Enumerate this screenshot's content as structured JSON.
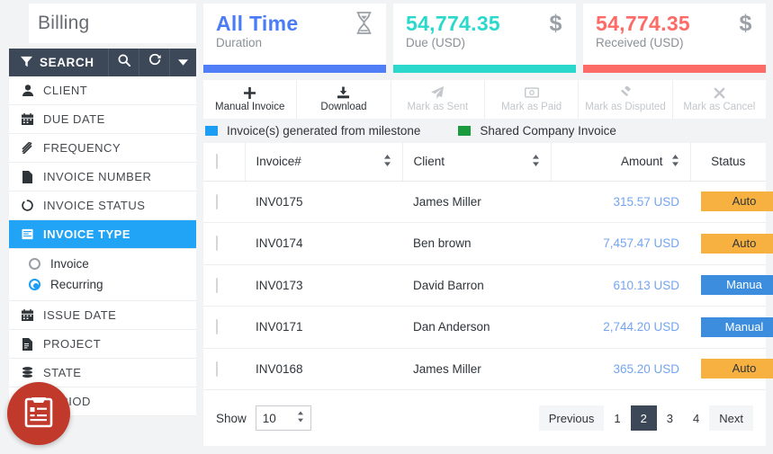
{
  "sidebar": {
    "title": "Billing",
    "search": {
      "label": "SEARCH",
      "filter_icon": "filter-icon",
      "search_icon": "search-icon",
      "refresh_icon": "refresh-icon",
      "caret_icon": "chevron-down-icon"
    },
    "items": [
      {
        "label": "CLIENT",
        "icon": "user-icon",
        "active": false
      },
      {
        "label": "DUE DATE",
        "icon": "calendar-icon",
        "active": false
      },
      {
        "label": "FREQUENCY",
        "icon": "frequency-icon",
        "active": false
      },
      {
        "label": "INVOICE NUMBER",
        "icon": "file-icon",
        "active": false
      },
      {
        "label": "INVOICE STATUS",
        "icon": "circle-notch-icon",
        "active": false
      },
      {
        "label": "INVOICE TYPE",
        "icon": "invoice-type-icon",
        "active": true
      },
      {
        "label": "ISSUE DATE",
        "icon": "calendar-icon",
        "active": false
      },
      {
        "label": "PROJECT",
        "icon": "project-file-icon",
        "active": false
      },
      {
        "label": "STATE",
        "icon": "database-icon",
        "active": false
      },
      {
        "label": "PERIOD",
        "icon": "period-icon",
        "active": false
      }
    ],
    "invoice_type_options": [
      {
        "label": "Invoice",
        "selected": false
      },
      {
        "label": "Recurring",
        "selected": true
      }
    ],
    "fab": {
      "icon": "invoice-clipboard-icon",
      "color": "#c0392b"
    }
  },
  "stats": [
    {
      "value": "All Time",
      "label": "Duration",
      "icon": "hourglass-icon",
      "value_color": "#4a7cf5",
      "bar_color": "#4f7ef7"
    },
    {
      "value": "54,774.35",
      "label": "Due (USD)",
      "icon": "dollar-icon",
      "value_color": "#2bd9cc",
      "bar_color": "#2bd9cc"
    },
    {
      "value": "54,774.35",
      "label": "Received (USD)",
      "icon": "dollar-icon",
      "value_color": "#fd6b66",
      "bar_color": "#fd6b66"
    }
  ],
  "toolbar": [
    {
      "label": "Manual Invoice",
      "icon": "plus-icon",
      "disabled": false
    },
    {
      "label": "Download",
      "icon": "download-icon",
      "disabled": false
    },
    {
      "label": "Mark as Sent",
      "icon": "paper-plane-icon",
      "disabled": true
    },
    {
      "label": "Mark as Paid",
      "icon": "money-bill-icon",
      "disabled": true
    },
    {
      "label": "Mark as Disputed",
      "icon": "gavel-icon",
      "disabled": true
    },
    {
      "label": "Mark as Cancel",
      "icon": "close-x-icon",
      "disabled": true
    }
  ],
  "legend": [
    {
      "label": "Invoice(s) generated from milestone",
      "color": "#1b9ef3"
    },
    {
      "label": "Shared Company Invoice",
      "color": "#1a9c3e"
    }
  ],
  "table": {
    "columns": [
      {
        "key": "checkbox",
        "label": "",
        "sortable": false
      },
      {
        "key": "invoice",
        "label": "Invoice#",
        "sortable": true
      },
      {
        "key": "client",
        "label": "Client",
        "sortable": true
      },
      {
        "key": "amount",
        "label": "Amount",
        "sortable": true
      },
      {
        "key": "status",
        "label": "Status",
        "sortable": false
      }
    ],
    "rows": [
      {
        "invoice": "INV0175",
        "client": "James Miller",
        "amount": "315.57 USD",
        "status": "Auto",
        "status_type": "auto"
      },
      {
        "invoice": "INV0174",
        "client": "Ben brown",
        "amount": "7,457.47 USD",
        "status": "Auto",
        "status_type": "auto"
      },
      {
        "invoice": "INV0173",
        "client": "David Barron",
        "amount": "610.13 USD",
        "status": "Manua",
        "status_type": "manual"
      },
      {
        "invoice": "INV0171",
        "client": "Dan Anderson",
        "amount": "2,744.20 USD",
        "status": "Manual",
        "status_type": "manual"
      },
      {
        "invoice": "INV0168",
        "client": "James Miller",
        "amount": "365.20 USD",
        "status": "Auto",
        "status_type": "auto"
      }
    ]
  },
  "footer": {
    "show_label": "Show",
    "page_size": "10",
    "previous": "Previous",
    "next": "Next",
    "pages": [
      "1",
      "2",
      "3",
      "4"
    ],
    "current_page": "2"
  },
  "colors": {
    "accent_blue": "#21a4f5",
    "dark_navy": "#3c4858",
    "badge_auto": "#f7b141",
    "badge_manual": "#3c8dde",
    "amount_link": "#74a5f0"
  }
}
